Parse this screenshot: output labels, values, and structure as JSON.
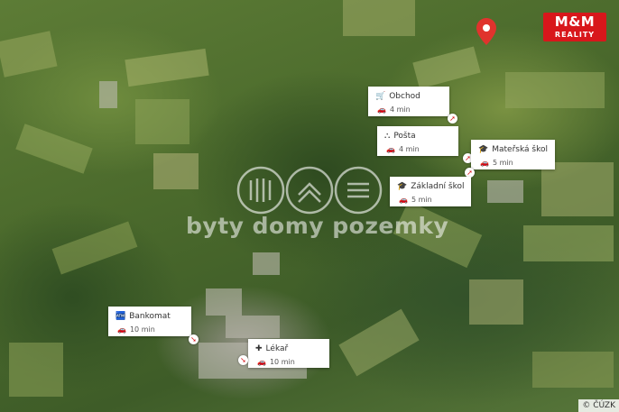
{
  "watermark_text": "byty domy pozemky",
  "logo": {
    "line1": "M&M",
    "line2": "REALITY"
  },
  "copyright": "© ČÚZK",
  "pois": [
    {
      "id": "obchod",
      "name": "Obchod",
      "icon": "cart-icon",
      "time": "4 min"
    },
    {
      "id": "posta",
      "name": "Pošta",
      "icon": "post-icon",
      "time": "4 min"
    },
    {
      "id": "materska",
      "name": "Mateřská škola N…",
      "icon": "school-icon",
      "time": "5 min"
    },
    {
      "id": "zakladni",
      "name": "Základní škola N…",
      "icon": "school-icon",
      "time": "5 min"
    },
    {
      "id": "bankomat",
      "name": "Bankomat",
      "icon": "atm-icon",
      "time": "10 min"
    },
    {
      "id": "lekar",
      "name": "Lékař",
      "icon": "medical-icon",
      "time": "10 min"
    }
  ],
  "colors": {
    "brand": "#d8171b",
    "pin": "#e0332d"
  }
}
